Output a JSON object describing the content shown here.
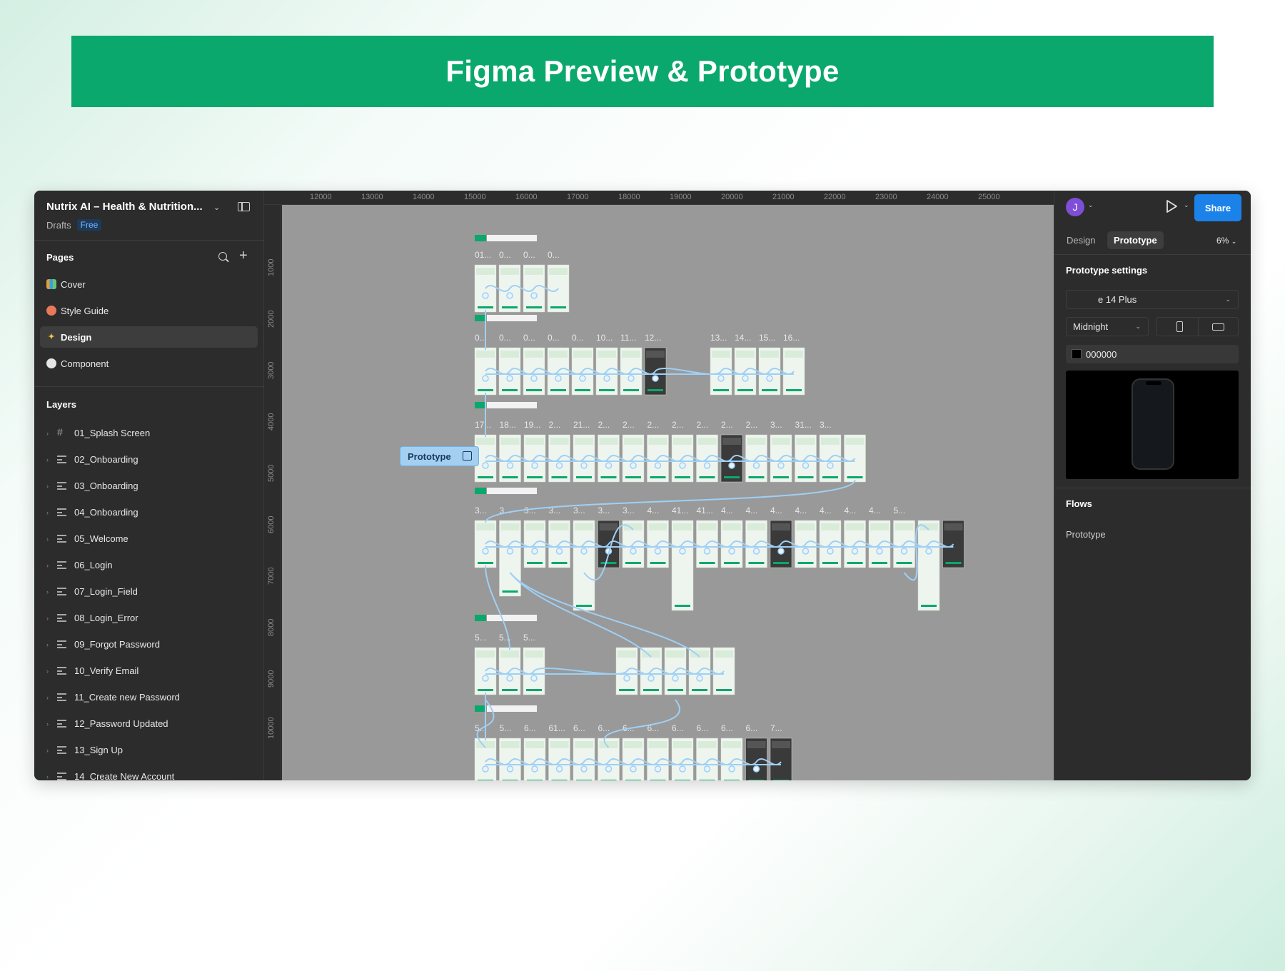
{
  "banner": {
    "title": "Figma Preview & Prototype"
  },
  "file": {
    "title": "Nutrix AI – Health & Nutrition...",
    "location": "Drafts",
    "plan": "Free"
  },
  "pages": {
    "label": "Pages",
    "items": [
      {
        "label": "Cover",
        "icon": "books-icon",
        "active": false
      },
      {
        "label": "Style Guide",
        "icon": "palette-icon",
        "active": false
      },
      {
        "label": "Design",
        "icon": "sparkles-icon",
        "active": true
      },
      {
        "label": "Component",
        "icon": "speech-bubble-icon",
        "active": false
      }
    ]
  },
  "layers": {
    "label": "Layers",
    "items": [
      {
        "label": "01_Splash Screen",
        "icon": "frame-icon"
      },
      {
        "label": "02_Onboarding",
        "icon": "autolayout-icon"
      },
      {
        "label": "03_Onboarding",
        "icon": "autolayout-icon"
      },
      {
        "label": "04_Onboarding",
        "icon": "autolayout-icon"
      },
      {
        "label": "05_Welcome",
        "icon": "autolayout-icon"
      },
      {
        "label": "06_Login",
        "icon": "autolayout-icon"
      },
      {
        "label": "07_Login_Field",
        "icon": "autolayout-icon"
      },
      {
        "label": "08_Login_Error",
        "icon": "autolayout-icon"
      },
      {
        "label": "09_Forgot Password",
        "icon": "autolayout-icon"
      },
      {
        "label": "10_Verify Email",
        "icon": "autolayout-icon"
      },
      {
        "label": "11_Create new Password",
        "icon": "autolayout-icon"
      },
      {
        "label": "12_Password Updated",
        "icon": "autolayout-icon"
      },
      {
        "label": "13_Sign Up",
        "icon": "autolayout-icon"
      },
      {
        "label": "14_Create New Account",
        "icon": "autolayout-icon"
      }
    ]
  },
  "rulers": {
    "top": [
      "12000",
      "13000",
      "14000",
      "15000",
      "16000",
      "17000",
      "18000",
      "19000",
      "20000",
      "21000",
      "22000",
      "23000",
      "24000",
      "25000"
    ],
    "left": [
      "1000",
      "2000",
      "3000",
      "4000",
      "5000",
      "6000",
      "7000",
      "8000",
      "9000",
      "10000"
    ]
  },
  "canvas": {
    "prototype_tag": "Prototype",
    "rows": [
      {
        "labels": [
          "01...",
          "0...",
          "0...",
          "0..."
        ],
        "frames": 4
      },
      {
        "labels": [
          "0...",
          "0...",
          "0...",
          "0...",
          "0...",
          "10...",
          "11...",
          "12...",
          "13...",
          "14...",
          "15...",
          "16..."
        ],
        "frames": 12
      },
      {
        "labels": [
          "17...",
          "18...",
          "19...",
          "2...",
          "21...",
          "2...",
          "2...",
          "2...",
          "2...",
          "2...",
          "2...",
          "2...",
          "3...",
          "31...",
          "3..."
        ],
        "frames": 16
      },
      {
        "labels": [
          "3...",
          "3...",
          "3...",
          "3...",
          "3...",
          "3...",
          "3...",
          "4...",
          "41...",
          "41...",
          "4...",
          "4...",
          "4...",
          "4...",
          "4...",
          "4...",
          "4...",
          "5..."
        ],
        "frames": 20
      },
      {
        "labels": [
          "5...",
          "5...",
          "5..."
        ],
        "frames": 8
      },
      {
        "labels": [
          "5...",
          "5...",
          "6...",
          "61...",
          "6...",
          "6...",
          "6...",
          "6...",
          "6...",
          "6...",
          "6...",
          "6...",
          "7..."
        ],
        "frames": 13
      }
    ]
  },
  "right_panel": {
    "avatar_initial": "J",
    "share_label": "Share",
    "tabs": [
      {
        "label": "Design",
        "active": false
      },
      {
        "label": "Prototype",
        "active": true
      }
    ],
    "zoom": "6%",
    "prototype_settings": {
      "title": "Prototype settings",
      "device": "e 14 Plus",
      "color_model": "Midnight",
      "background_hex": "000000"
    },
    "flows": {
      "title": "Flows",
      "items": [
        "Prototype"
      ]
    }
  },
  "colors": {
    "brand_green": "#0aa86c",
    "share_blue": "#1a82e8",
    "connector_blue": "#9fd0f5",
    "canvas_gray": "#999999"
  }
}
